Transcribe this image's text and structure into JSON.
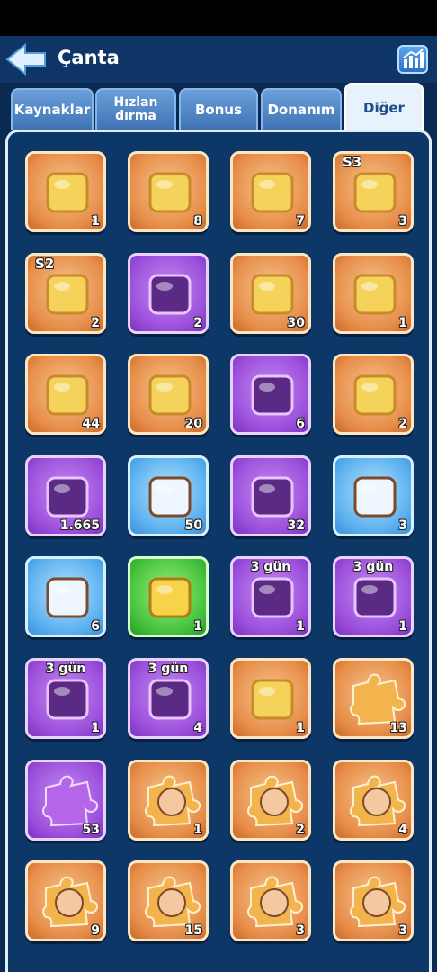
{
  "header": {
    "title": "Çanta"
  },
  "tabs": [
    {
      "label": "Kaynaklar"
    },
    {
      "label": "Hızlan dırma"
    },
    {
      "label": "Bonus"
    },
    {
      "label": "Donanım"
    },
    {
      "label": "Diğer"
    }
  ],
  "active_tab": "Diğer",
  "items": [
    {
      "icon": "ticket-30-icon",
      "count": "1",
      "color": "orange",
      "badge": ""
    },
    {
      "icon": "scroll-icon",
      "count": "8",
      "color": "orange",
      "badge": ""
    },
    {
      "icon": "mystery-metal-chest-icon",
      "count": "7",
      "color": "orange",
      "badge": ""
    },
    {
      "icon": "s3-treasure-chest-icon",
      "count": "3",
      "color": "orange",
      "badge": "S3"
    },
    {
      "icon": "s2-treasure-chest-icon",
      "count": "2",
      "color": "orange",
      "badge": "S2"
    },
    {
      "icon": "dark-crystal-stone-icon",
      "count": "2",
      "color": "purple",
      "badge": ""
    },
    {
      "icon": "purple-s-token-icon",
      "count": "30",
      "color": "orange",
      "badge": ""
    },
    {
      "icon": "blue-swap-card-icon",
      "count": "1",
      "color": "orange",
      "badge": ""
    },
    {
      "icon": "firework-rocket-2-icon",
      "count": "44",
      "color": "orange",
      "badge": ""
    },
    {
      "icon": "paw-cookie-icon",
      "count": "20",
      "color": "orange",
      "badge": ""
    },
    {
      "icon": "mystery-card-icon",
      "count": "6",
      "color": "purple",
      "badge": ""
    },
    {
      "icon": "twin-rocket-icon",
      "count": "2",
      "color": "orange",
      "badge": ""
    },
    {
      "icon": "gold-mystery-badge-icon",
      "count": "1.665",
      "color": "purple",
      "badge": ""
    },
    {
      "icon": "claw-horn-icon",
      "count": "50",
      "color": "blue",
      "badge": ""
    },
    {
      "icon": "purple-statue-platform-icon",
      "count": "32",
      "color": "purple",
      "badge": ""
    },
    {
      "icon": "blue-statue-platform-icon",
      "count": "3",
      "color": "blue",
      "badge": ""
    },
    {
      "icon": "star-banner-platform-icon",
      "count": "6",
      "color": "blue",
      "badge": ""
    },
    {
      "icon": "mystery-platform-icon",
      "count": "1",
      "color": "green",
      "badge": ""
    },
    {
      "icon": "ice-fortress-icon",
      "count": "1",
      "color": "purple",
      "badge": "3 gün"
    },
    {
      "icon": "golden-throne-icon",
      "count": "1",
      "color": "purple",
      "badge": "3 gün"
    },
    {
      "icon": "blue-castle-icon",
      "count": "1",
      "color": "purple",
      "badge": "3 gün"
    },
    {
      "icon": "skull-gate-frame-icon",
      "count": "4",
      "color": "purple",
      "badge": "3 gün"
    },
    {
      "icon": "detective-girl-icon",
      "count": "1",
      "color": "orange",
      "badge": ""
    },
    {
      "icon": "gold-puzzle-piece-icon",
      "count": "13",
      "color": "orange",
      "badge": ""
    },
    {
      "icon": "purple-puzzle-piece-icon",
      "count": "53",
      "color": "purple",
      "badge": ""
    },
    {
      "icon": "hero-puzzle-blonde-girl-icon",
      "count": "1",
      "color": "orange",
      "badge": ""
    },
    {
      "icon": "hero-puzzle-warrior-icon",
      "count": "2",
      "color": "orange",
      "badge": ""
    },
    {
      "icon": "hero-puzzle-elf-icon",
      "count": "4",
      "color": "orange",
      "badge": ""
    },
    {
      "icon": "hero-puzzle-pink-girl-icon",
      "count": "9",
      "color": "orange",
      "badge": ""
    },
    {
      "icon": "hero-puzzle-hat-icon",
      "count": "15",
      "color": "orange",
      "badge": ""
    },
    {
      "icon": "hero-puzzle-old-man-icon",
      "count": "3",
      "color": "orange",
      "badge": ""
    },
    {
      "icon": "hero-puzzle-goggles-icon",
      "count": "3",
      "color": "orange",
      "badge": ""
    }
  ]
}
